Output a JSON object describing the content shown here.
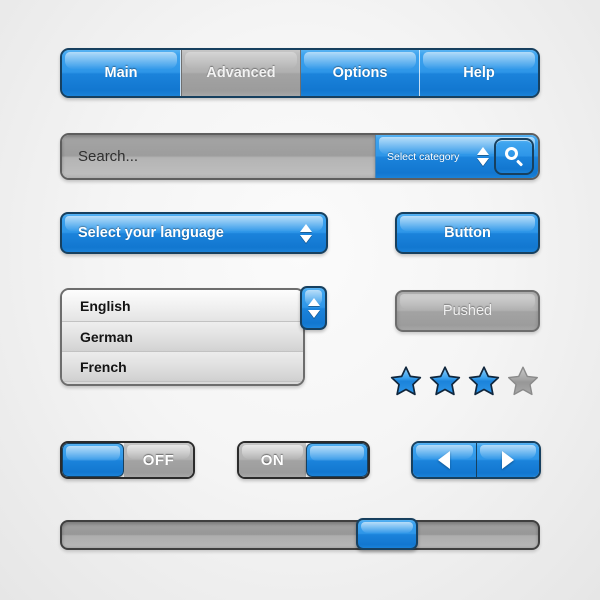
{
  "theme": {
    "accent_blue": "#2e96e8",
    "accent_blue_light": "#57b2f2",
    "accent_blue_dark": "#1277d0",
    "border_navy": "#17405f",
    "gray_face": "#b1b1b1",
    "background": "#f2f2f2",
    "star_active": "#2e96e8",
    "star_inactive": "#9e9e9e"
  },
  "tabs": {
    "items": [
      {
        "label": "Main",
        "state": "normal"
      },
      {
        "label": "Advanced",
        "state": "active"
      },
      {
        "label": "Options",
        "state": "normal"
      },
      {
        "label": "Help",
        "state": "normal"
      }
    ]
  },
  "search": {
    "placeholder": "Search...",
    "value": "",
    "category_label": "Select category",
    "search_icon": "magnifier-icon",
    "spinner_icon": "spinner-up-down-icon"
  },
  "select": {
    "label": "Select your language",
    "spinner_icon": "spinner-up-down-icon"
  },
  "buttons": {
    "normal_label": "Button",
    "pushed_label": "Pushed"
  },
  "listbox": {
    "items": [
      "English",
      "German",
      "French"
    ],
    "scroll_icon": "scroll-up-down-icon"
  },
  "rating": {
    "value": 3,
    "max": 4,
    "stars": [
      "filled",
      "filled",
      "filled",
      "empty"
    ]
  },
  "toggles": [
    {
      "label": "OFF",
      "state": "off",
      "knob_side": "left"
    },
    {
      "label": "ON",
      "state": "on",
      "knob_side": "right"
    }
  ],
  "arrow_pair": {
    "prev_icon": "arrow-left-icon",
    "next_icon": "arrow-right-icon"
  },
  "slider": {
    "value_percent": 71,
    "min": 0,
    "max": 100
  }
}
